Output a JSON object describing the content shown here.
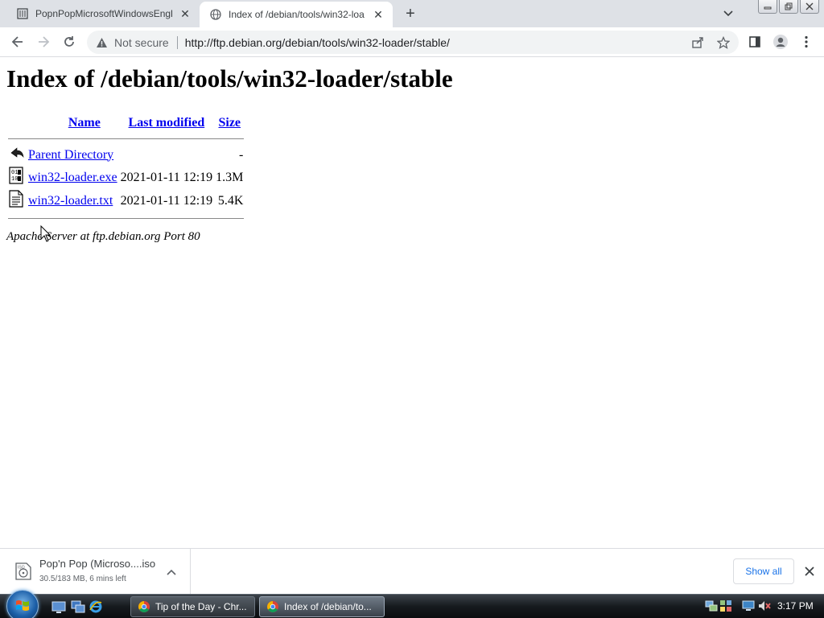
{
  "browser": {
    "tabs": [
      {
        "title": "PopnPopMicrosoftWindowsEngli",
        "icon": "archive-icon",
        "active": false
      },
      {
        "title": "Index of /debian/tools/win32-loa",
        "icon": "globe-icon",
        "active": true
      }
    ],
    "omnibox": {
      "security_label": "Not secure",
      "url": "http://ftp.debian.org/debian/tools/win32-loader/stable/"
    }
  },
  "page": {
    "heading": "Index of /debian/tools/win32-loader/stable",
    "columns": {
      "name": "Name",
      "last_modified": "Last modified",
      "size": "Size"
    },
    "rows": [
      {
        "icon": "back-arrow-icon",
        "name": "Parent Directory",
        "modified": "",
        "size": "-"
      },
      {
        "icon": "binary-file-icon",
        "name": "win32-loader.exe",
        "modified": "2021-01-11 12:19",
        "size": "1.3M"
      },
      {
        "icon": "text-file-icon",
        "name": "win32-loader.txt",
        "modified": "2021-01-11 12:19",
        "size": "5.4K"
      }
    ],
    "address": "Apache Server at ftp.debian.org Port 80"
  },
  "download_shelf": {
    "item": {
      "name": "Pop'n Pop (Microso....iso",
      "status": "30.5/183 MB, 6 mins left",
      "icon": "iso-file-icon"
    },
    "show_all_label": "Show all"
  },
  "taskbar": {
    "windows": [
      {
        "title": "Tip of the Day - Chr...",
        "icon": "chrome-icon"
      },
      {
        "title": "Index of /debian/to...",
        "icon": "chrome-icon"
      }
    ],
    "clock": "3:17 PM"
  }
}
